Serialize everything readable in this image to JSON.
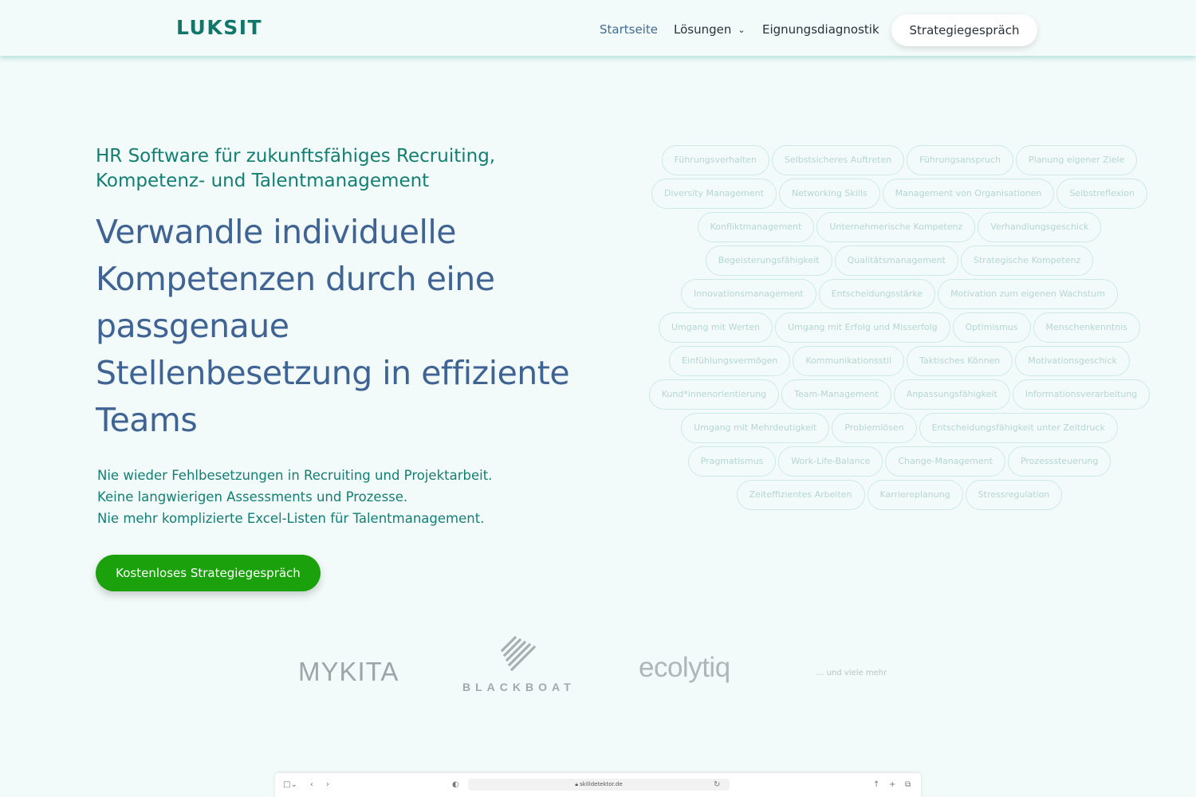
{
  "header": {
    "logo": "LUKSIT",
    "nav": {
      "home": "Startseite",
      "solutions": "Lösungen",
      "diagnostics": "Eignungsdiagnostik",
      "cta": "Strategiegespräch"
    },
    "chevron_icon": "chevron-down-icon"
  },
  "hero": {
    "eyebrow": "HR Software für zukunftsfähiges Recruiting, Kompetenz- und Talentmanagement",
    "headline_lines": [
      "Verwandle individuelle",
      "Kompetenzen durch eine",
      "passgenaue",
      "Stellenbesetzung in effiziente",
      "Teams"
    ],
    "benefits": [
      "Nie wieder Fehlbesetzungen in Recruiting und Projektarbeit.",
      "Keine langwierigen Assessments und Prozesse.",
      "Nie mehr komplizierte Excel-Listen für Talentmanagement."
    ],
    "cta": "Kostenloses Strategiegespräch"
  },
  "skills": [
    [
      "Führungsverhalten",
      "Selbstsicheres Auftreten",
      "Führungsanspruch",
      "Planung eigener Ziele"
    ],
    [
      "Diversity Management",
      "Networking Skills",
      "Management von Organisationen",
      "Selbstreflexion"
    ],
    [
      "Konfliktmanagement",
      "Unternehmerische Kompetenz",
      "Verhandlungsgeschick"
    ],
    [
      "Begeisterungsfähigkeit",
      "Qualitätsmanagement",
      "Strategische Kompetenz"
    ],
    [
      "Innovationsmanagement",
      "Entscheidungsstärke",
      "Motivation zum eigenen Wachstum"
    ],
    [
      "Umgang mit Werten",
      "Umgang mit Erfolg und Misserfolg",
      "Optimismus",
      "Menschenkenntnis"
    ],
    [
      "Einfühlungsvermögen",
      "Kommunikationsstil",
      "Taktisches Können",
      "Motivationsgeschick"
    ],
    [
      "Kund*innenorientierung",
      "Team-Management",
      "Anpassungsfähigkeit",
      "Informationsverarbeitung"
    ],
    [
      "Umgang mit Mehrdeutigkeit",
      "Problemlösen",
      "Entscheidungsfähigkeit unter Zeitdruck"
    ],
    [
      "Pragmatismus",
      "Work-Life-Balance",
      "Change-Management",
      "Prozesssteuerung"
    ],
    [
      "Zeiteffizientes Arbeiten",
      "Karriereplanung",
      "Stressregulation"
    ]
  ],
  "clients": {
    "mykita": "MYKITA",
    "blackboat": "BLACKBOAT",
    "ecolytiq": "ecolytiq",
    "more": "... und viele mehr"
  },
  "browser": {
    "url": "skilldetektor.de"
  },
  "colors": {
    "background": "#f3fafa",
    "brand_teal": "#137f73",
    "headline_blue": "#3f6494",
    "cta_green": "#1aa10b"
  }
}
